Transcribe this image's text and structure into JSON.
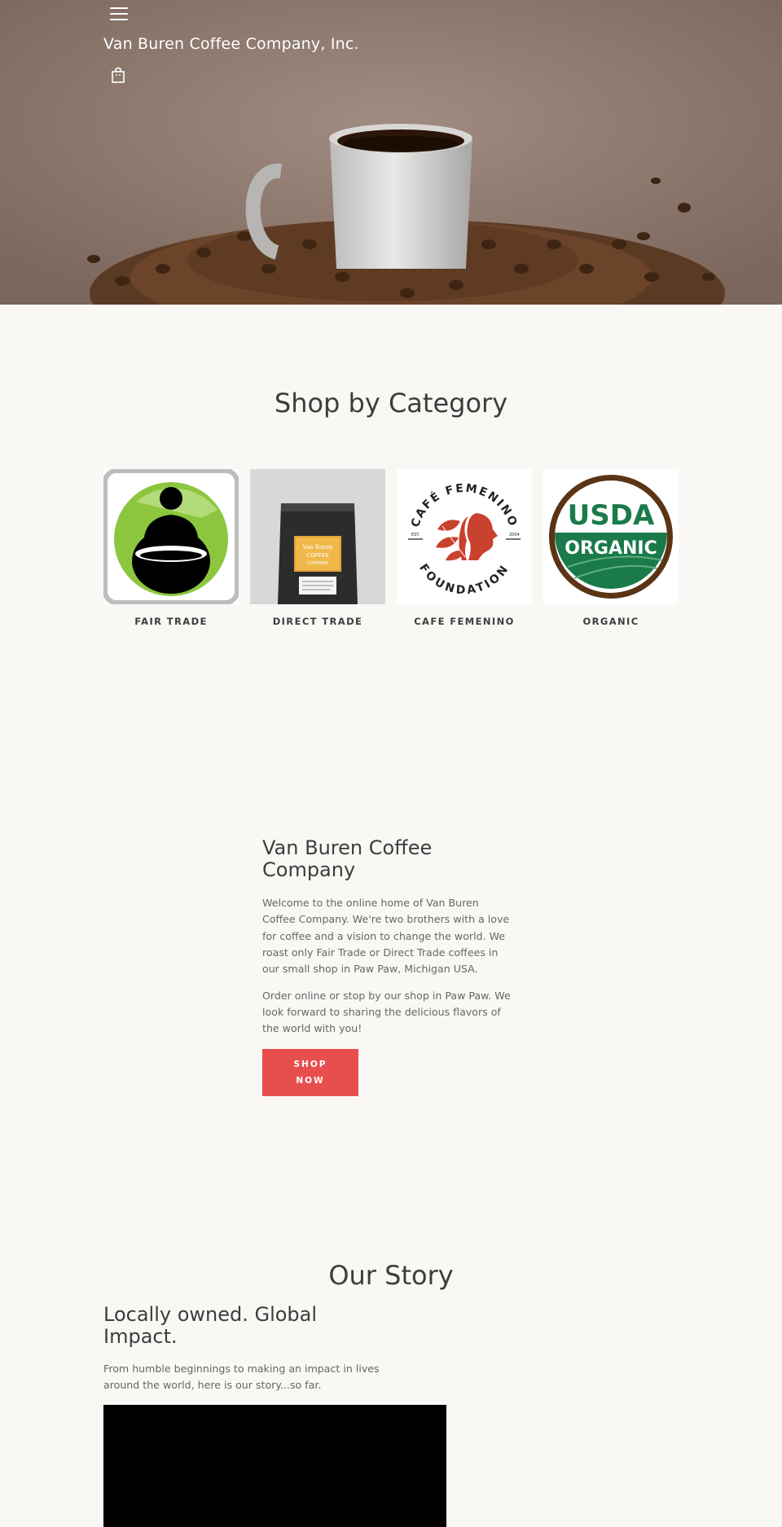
{
  "header": {
    "site_title": "Van Buren Coffee Company, Inc.",
    "menu_icon": "hamburger-menu-icon",
    "cart_icon": "shopping-bag-icon"
  },
  "categories": {
    "heading": "Shop by Category",
    "items": [
      {
        "label": "FAIR TRADE",
        "icon": "fair-trade-logo"
      },
      {
        "label": "DIRECT TRADE",
        "icon": "coffee-bag-image"
      },
      {
        "label": "CAFE FEMENINO",
        "icon": "cafe-femenino-logo",
        "logo_text_top": "CAFÉ FEMENINO",
        "logo_text_bottom": "FOUNDATION",
        "logo_est": "EST.",
        "logo_year": "2004"
      },
      {
        "label": "ORGANIC",
        "icon": "usda-organic-logo",
        "logo_text_top": "USDA",
        "logo_text_bottom": "ORGANIC"
      }
    ]
  },
  "bag": {
    "brand_line1": "Van Buren",
    "brand_line2": "COFFEE",
    "brand_line3": "COMPANY"
  },
  "about": {
    "title": "Van Buren Coffee Company",
    "paragraph1": "Welcome to the online home of Van Buren Coffee Company. We're two brothers with a love for coffee and a vision to change the world. We roast only Fair Trade or Direct Trade coffees in our small shop in Paw Paw, Michigan USA.",
    "paragraph2": "Order online or stop by our shop in Paw Paw. We look forward to sharing the delicious flavors of the world with you!",
    "button_line1": "SHOP",
    "button_line2": "NOW"
  },
  "story": {
    "heading": "Our Story",
    "subheading": "Locally owned. Global Impact.",
    "text": "From humble beginnings to making an impact in lives around the world, here is our story...so far."
  },
  "colors": {
    "background": "#f9f8f5",
    "accent_button": "#e94e4e",
    "text_dark": "#3d3d3d",
    "text_body": "#666666",
    "usda_green": "#1a7a4a",
    "usda_brown": "#5a3414",
    "fairtrade_green": "#8cc63f",
    "femenino_red": "#c9422d"
  }
}
